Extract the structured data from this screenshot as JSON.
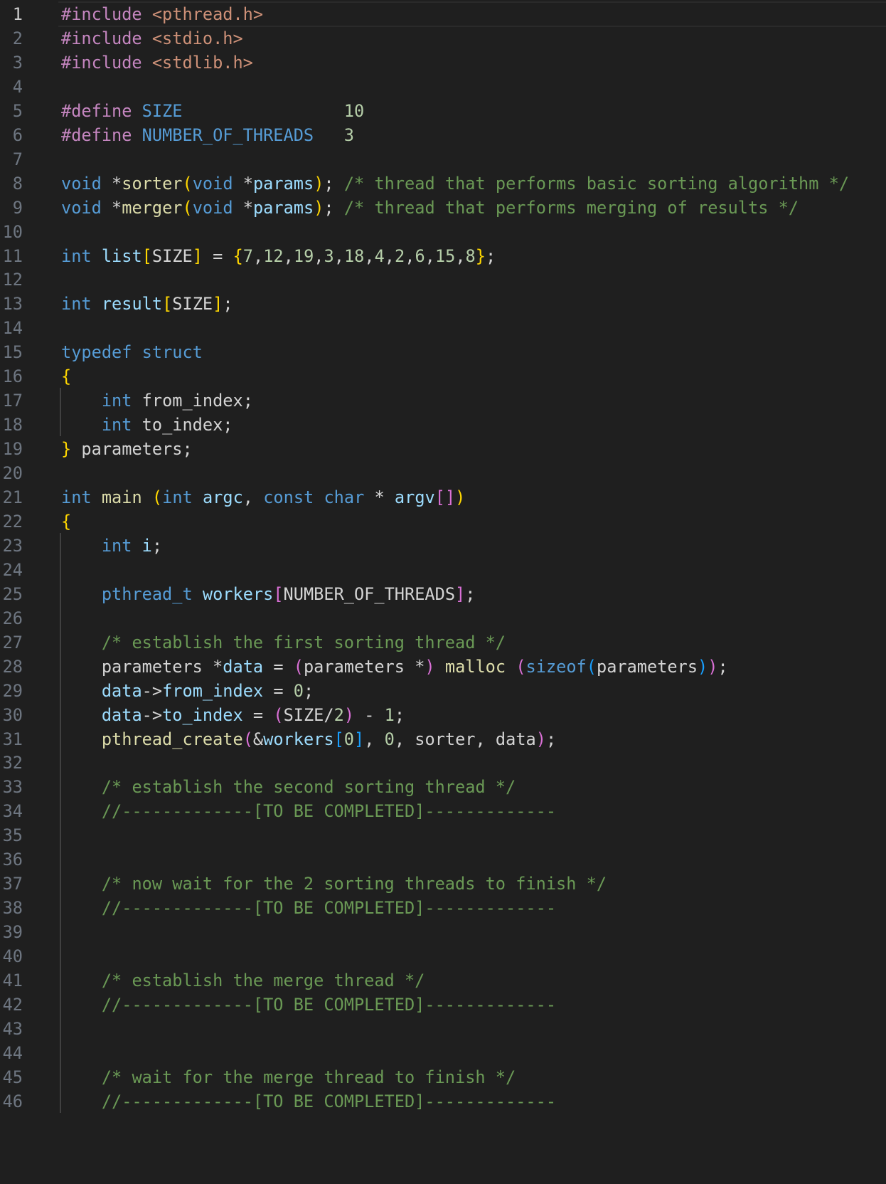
{
  "editor": {
    "language": "c",
    "theme_colors": {
      "background": "#1f1f1f",
      "keyword": "#569cd6",
      "preprocessor": "#c586c0",
      "string": "#ce9178",
      "number": "#b5cea8",
      "function": "#dcdcaa",
      "variable": "#9cdcfe",
      "comment": "#6a9955",
      "bracket1": "#ffd700",
      "bracket2": "#da70d6",
      "bracket3": "#179fff",
      "line_number": "#6e7681"
    },
    "active_line": 1,
    "lines": [
      {
        "n": "1",
        "tokens": [
          [
            "pp",
            "#include "
          ],
          [
            "str",
            "<pthread.h>"
          ]
        ]
      },
      {
        "n": "2",
        "tokens": [
          [
            "pp",
            "#include "
          ],
          [
            "str",
            "<stdio.h>"
          ]
        ]
      },
      {
        "n": "3",
        "tokens": [
          [
            "pp",
            "#include "
          ],
          [
            "str",
            "<stdlib.h>"
          ]
        ]
      },
      {
        "n": "4",
        "tokens": []
      },
      {
        "n": "5",
        "tokens": [
          [
            "pp",
            "#define "
          ],
          [
            "mac",
            "SIZE"
          ],
          [
            "pl",
            "                "
          ],
          [
            "num",
            "10"
          ]
        ]
      },
      {
        "n": "6",
        "tokens": [
          [
            "pp",
            "#define "
          ],
          [
            "mac",
            "NUMBER_OF_THREADS"
          ],
          [
            "pl",
            "   "
          ],
          [
            "num",
            "3"
          ]
        ]
      },
      {
        "n": "7",
        "tokens": []
      },
      {
        "n": "8",
        "tokens": [
          [
            "kw",
            "void"
          ],
          [
            "pl",
            " *"
          ],
          [
            "fn",
            "sorter"
          ],
          [
            "b1",
            "("
          ],
          [
            "kw",
            "void"
          ],
          [
            "pl",
            " *"
          ],
          [
            "var",
            "params"
          ],
          [
            "b1",
            ")"
          ],
          [
            "pl",
            "; "
          ],
          [
            "cm",
            "/* thread that performs basic sorting algorithm */"
          ]
        ]
      },
      {
        "n": "9",
        "tokens": [
          [
            "kw",
            "void"
          ],
          [
            "pl",
            " *"
          ],
          [
            "fn",
            "merger"
          ],
          [
            "b1",
            "("
          ],
          [
            "kw",
            "void"
          ],
          [
            "pl",
            " *"
          ],
          [
            "var",
            "params"
          ],
          [
            "b1",
            ")"
          ],
          [
            "pl",
            "; "
          ],
          [
            "cm",
            "/* thread that performs merging of results */"
          ]
        ]
      },
      {
        "n": "10",
        "tokens": []
      },
      {
        "n": "11",
        "tokens": [
          [
            "kw",
            "int"
          ],
          [
            "pl",
            " "
          ],
          [
            "var",
            "list"
          ],
          [
            "b1",
            "["
          ],
          [
            "pl",
            "SIZE"
          ],
          [
            "b1",
            "]"
          ],
          [
            "pl",
            " = "
          ],
          [
            "b1",
            "{"
          ],
          [
            "num",
            "7"
          ],
          [
            "pl",
            ","
          ],
          [
            "num",
            "12"
          ],
          [
            "pl",
            ","
          ],
          [
            "num",
            "19"
          ],
          [
            "pl",
            ","
          ],
          [
            "num",
            "3"
          ],
          [
            "pl",
            ","
          ],
          [
            "num",
            "18"
          ],
          [
            "pl",
            ","
          ],
          [
            "num",
            "4"
          ],
          [
            "pl",
            ","
          ],
          [
            "num",
            "2"
          ],
          [
            "pl",
            ","
          ],
          [
            "num",
            "6"
          ],
          [
            "pl",
            ","
          ],
          [
            "num",
            "15"
          ],
          [
            "pl",
            ","
          ],
          [
            "num",
            "8"
          ],
          [
            "b1",
            "}"
          ],
          [
            "pl",
            ";"
          ]
        ]
      },
      {
        "n": "12",
        "tokens": []
      },
      {
        "n": "13",
        "tokens": [
          [
            "kw",
            "int"
          ],
          [
            "pl",
            " "
          ],
          [
            "var",
            "result"
          ],
          [
            "b1",
            "["
          ],
          [
            "pl",
            "SIZE"
          ],
          [
            "b1",
            "]"
          ],
          [
            "pl",
            ";"
          ]
        ]
      },
      {
        "n": "14",
        "tokens": []
      },
      {
        "n": "15",
        "tokens": [
          [
            "kw",
            "typedef"
          ],
          [
            "pl",
            " "
          ],
          [
            "kw",
            "struct"
          ]
        ]
      },
      {
        "n": "16",
        "tokens": [
          [
            "b1",
            "{"
          ]
        ]
      },
      {
        "n": "17",
        "tokens": [
          [
            "pl",
            "    "
          ],
          [
            "kw",
            "int"
          ],
          [
            "pl",
            " from_index;"
          ]
        ]
      },
      {
        "n": "18",
        "tokens": [
          [
            "pl",
            "    "
          ],
          [
            "kw",
            "int"
          ],
          [
            "pl",
            " to_index;"
          ]
        ]
      },
      {
        "n": "19",
        "tokens": [
          [
            "b1",
            "}"
          ],
          [
            "pl",
            " parameters;"
          ]
        ]
      },
      {
        "n": "20",
        "tokens": []
      },
      {
        "n": "21",
        "tokens": [
          [
            "kw",
            "int"
          ],
          [
            "pl",
            " "
          ],
          [
            "fn",
            "main"
          ],
          [
            "pl",
            " "
          ],
          [
            "b1",
            "("
          ],
          [
            "kw",
            "int"
          ],
          [
            "pl",
            " "
          ],
          [
            "var",
            "argc"
          ],
          [
            "pl",
            ", "
          ],
          [
            "kw",
            "const"
          ],
          [
            "pl",
            " "
          ],
          [
            "kw",
            "char"
          ],
          [
            "pl",
            " * "
          ],
          [
            "var",
            "argv"
          ],
          [
            "b2",
            "[]"
          ],
          [
            "b1",
            ")"
          ]
        ]
      },
      {
        "n": "22",
        "tokens": [
          [
            "b1",
            "{"
          ]
        ]
      },
      {
        "n": "23",
        "tokens": [
          [
            "pl",
            "    "
          ],
          [
            "kw",
            "int"
          ],
          [
            "pl",
            " "
          ],
          [
            "var",
            "i"
          ],
          [
            "pl",
            ";"
          ]
        ]
      },
      {
        "n": "24",
        "tokens": []
      },
      {
        "n": "25",
        "tokens": [
          [
            "pl",
            "    "
          ],
          [
            "kw",
            "pthread_t"
          ],
          [
            "pl",
            " "
          ],
          [
            "var",
            "workers"
          ],
          [
            "b2",
            "["
          ],
          [
            "pl",
            "NUMBER_OF_THREADS"
          ],
          [
            "b2",
            "]"
          ],
          [
            "pl",
            ";"
          ]
        ]
      },
      {
        "n": "26",
        "tokens": []
      },
      {
        "n": "27",
        "tokens": [
          [
            "pl",
            "    "
          ],
          [
            "cm",
            "/* establish the first sorting thread */"
          ]
        ]
      },
      {
        "n": "28",
        "tokens": [
          [
            "pl",
            "    parameters *"
          ],
          [
            "var",
            "data"
          ],
          [
            "pl",
            " = "
          ],
          [
            "b2",
            "("
          ],
          [
            "pl",
            "parameters *"
          ],
          [
            "b2",
            ")"
          ],
          [
            "pl",
            " "
          ],
          [
            "fn",
            "malloc"
          ],
          [
            "pl",
            " "
          ],
          [
            "b2",
            "("
          ],
          [
            "kw",
            "sizeof"
          ],
          [
            "b3",
            "("
          ],
          [
            "pl",
            "parameters"
          ],
          [
            "b3",
            ")"
          ],
          [
            "b2",
            ")"
          ],
          [
            "pl",
            ";"
          ]
        ]
      },
      {
        "n": "29",
        "tokens": [
          [
            "pl",
            "    "
          ],
          [
            "var",
            "data"
          ],
          [
            "pl",
            "->"
          ],
          [
            "var",
            "from_index"
          ],
          [
            "pl",
            " = "
          ],
          [
            "num",
            "0"
          ],
          [
            "pl",
            ";"
          ]
        ]
      },
      {
        "n": "30",
        "tokens": [
          [
            "pl",
            "    "
          ],
          [
            "var",
            "data"
          ],
          [
            "pl",
            "->"
          ],
          [
            "var",
            "to_index"
          ],
          [
            "pl",
            " = "
          ],
          [
            "b2",
            "("
          ],
          [
            "pl",
            "SIZE/"
          ],
          [
            "num",
            "2"
          ],
          [
            "b2",
            ")"
          ],
          [
            "pl",
            " - "
          ],
          [
            "num",
            "1"
          ],
          [
            "pl",
            ";"
          ]
        ]
      },
      {
        "n": "31",
        "tokens": [
          [
            "pl",
            "    "
          ],
          [
            "fn",
            "pthread_create"
          ],
          [
            "b2",
            "("
          ],
          [
            "pl",
            "&"
          ],
          [
            "var",
            "workers"
          ],
          [
            "b3",
            "["
          ],
          [
            "num",
            "0"
          ],
          [
            "b3",
            "]"
          ],
          [
            "pl",
            ", "
          ],
          [
            "num",
            "0"
          ],
          [
            "pl",
            ", sorter, data"
          ],
          [
            "b2",
            ")"
          ],
          [
            "pl",
            ";"
          ]
        ]
      },
      {
        "n": "32",
        "tokens": []
      },
      {
        "n": "33",
        "tokens": [
          [
            "pl",
            "    "
          ],
          [
            "cm",
            "/* establish the second sorting thread */"
          ]
        ]
      },
      {
        "n": "34",
        "tokens": [
          [
            "pl",
            "    "
          ],
          [
            "cm",
            "//-------------[TO BE COMPLETED]-------------"
          ]
        ]
      },
      {
        "n": "35",
        "tokens": []
      },
      {
        "n": "36",
        "tokens": []
      },
      {
        "n": "37",
        "tokens": [
          [
            "pl",
            "    "
          ],
          [
            "cm",
            "/* now wait for the 2 sorting threads to finish */"
          ]
        ]
      },
      {
        "n": "38",
        "tokens": [
          [
            "pl",
            "    "
          ],
          [
            "cm",
            "//-------------[TO BE COMPLETED]-------------"
          ]
        ]
      },
      {
        "n": "39",
        "tokens": []
      },
      {
        "n": "40",
        "tokens": []
      },
      {
        "n": "41",
        "tokens": [
          [
            "pl",
            "    "
          ],
          [
            "cm",
            "/* establish the merge thread */"
          ]
        ]
      },
      {
        "n": "42",
        "tokens": [
          [
            "pl",
            "    "
          ],
          [
            "cm",
            "//-------------[TO BE COMPLETED]-------------"
          ]
        ]
      },
      {
        "n": "43",
        "tokens": []
      },
      {
        "n": "44",
        "tokens": []
      },
      {
        "n": "45",
        "tokens": [
          [
            "pl",
            "    "
          ],
          [
            "cm",
            "/* wait for the merge thread to finish */"
          ]
        ]
      },
      {
        "n": "46",
        "tokens": [
          [
            "pl",
            "    "
          ],
          [
            "cm",
            "//-------------[TO BE COMPLETED]-------------"
          ]
        ]
      }
    ]
  }
}
